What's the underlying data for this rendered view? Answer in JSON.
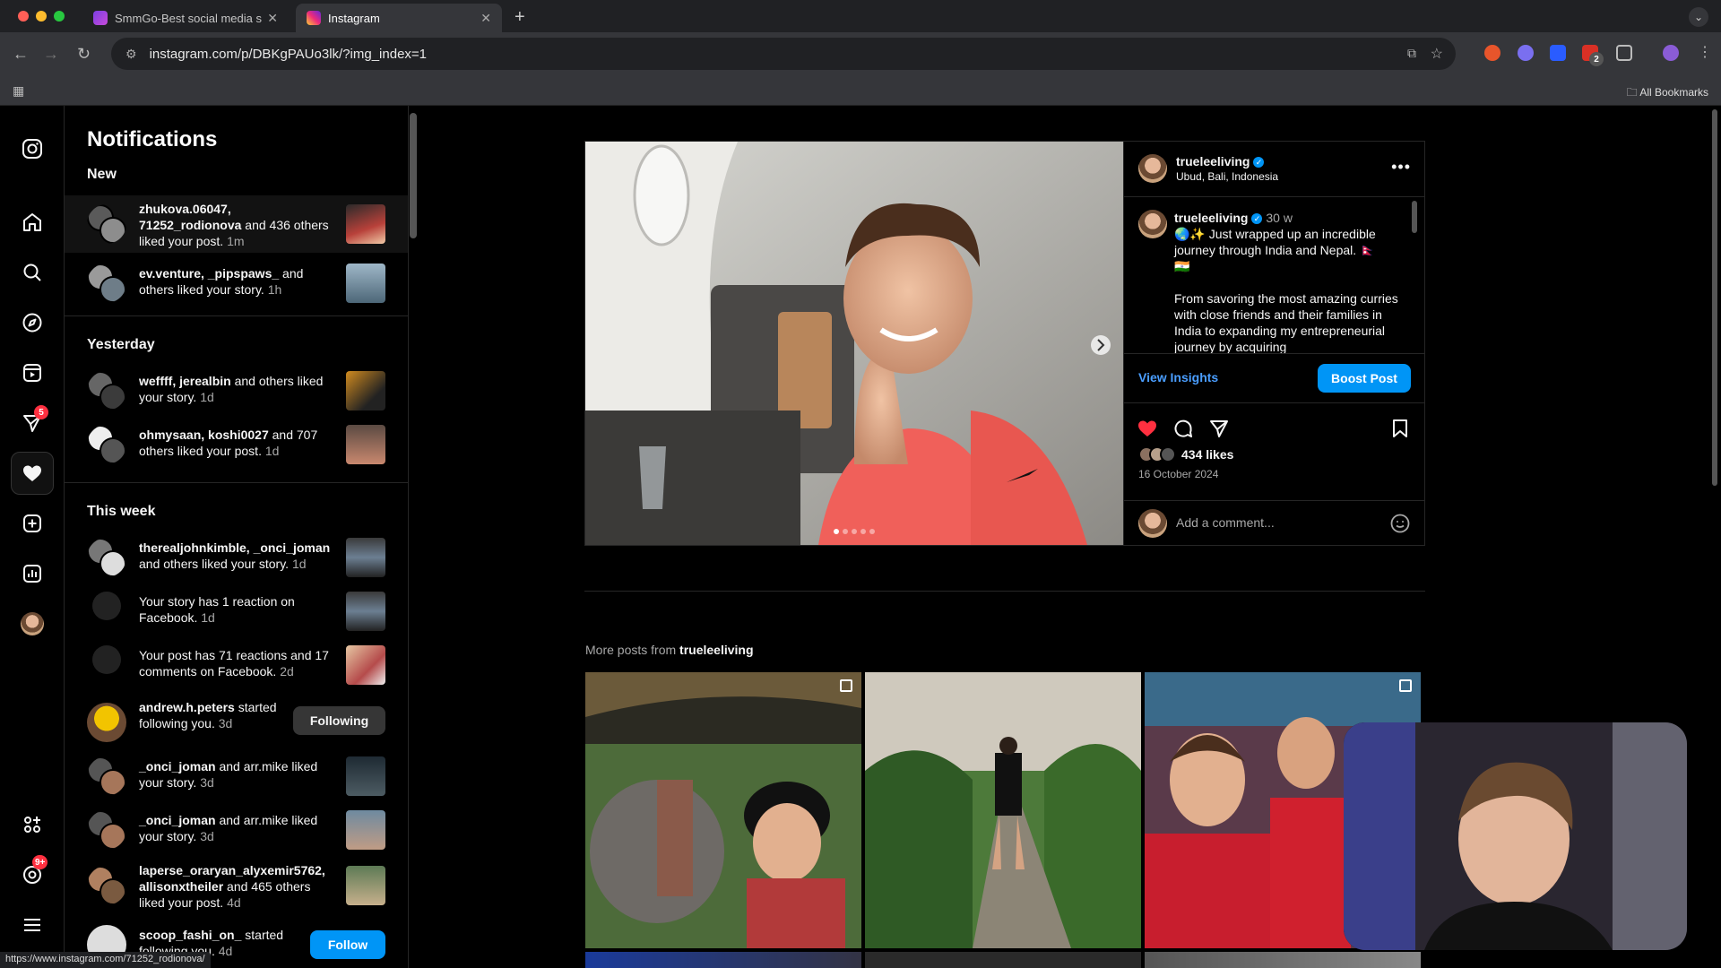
{
  "browser": {
    "tabs": [
      {
        "title": "SmmGo-Best social media se",
        "active": false
      },
      {
        "title": "Instagram",
        "active": true
      }
    ],
    "url": "instagram.com/p/DBKgPAUo3lk/?img_index=1",
    "bookmarks_label": "All Bookmarks",
    "status_url": "https://www.instagram.com/71252_rodionova/",
    "extension_badge": "2"
  },
  "rail": {
    "messages_badge": "5",
    "threads_badge": "9+"
  },
  "notifications": {
    "title": "Notifications",
    "sections": {
      "new": "New",
      "yesterday": "Yesterday",
      "this_week": "This week"
    },
    "items": [
      {
        "users": "zhukova.06047, 71252_rodionova",
        "text": " and 436 others liked your post.",
        "time": "1m"
      },
      {
        "users": "ev.venture, _pipspaws_",
        "text": " and others liked your story.",
        "time": "1h"
      },
      {
        "users": "weffff, jerealbin",
        "text": " and others liked your story.",
        "time": "1d"
      },
      {
        "users": "ohmysaan, koshi0027",
        "text": " and 707 others liked your post.",
        "time": "1d"
      },
      {
        "users": "therealjohnkimble, _onci_joman",
        "text": " and others liked your story.",
        "time": "1d"
      },
      {
        "users": "",
        "text": "Your story has 1 reaction on Facebook.",
        "time": "1d"
      },
      {
        "users": "",
        "text": "Your post has 71 reactions and 17 comments on Facebook.",
        "time": "2d"
      },
      {
        "users": "andrew.h.peters",
        "text": " started following you.",
        "time": "3d",
        "button": "Following"
      },
      {
        "users": "_onci_joman",
        "text": " and arr.mike liked your story.",
        "time": "3d"
      },
      {
        "users": "_onci_joman",
        "text": " and arr.mike liked your story.",
        "time": "3d"
      },
      {
        "users": "laperse_oraryan_alyxemir5762, allisonxtheiler",
        "text": " and 465 others liked your post.",
        "time": "4d"
      },
      {
        "users": "scoop_fashi_on_",
        "text": " started following you.",
        "time": "4d",
        "button": "Follow"
      }
    ]
  },
  "post": {
    "username": "trueleeliving",
    "location": "Ubud, Bali, Indonesia",
    "caption_time": "30 w",
    "caption_line1": "🌏✨ Just wrapped up an incredible journey through India and Nepal. 🇳🇵",
    "caption_line2": "🇮🇳",
    "caption_paragraph": "From savoring the most amazing curries with close friends and their families in India to expanding my entrepreneurial journey by acquiring",
    "view_insights": "View Insights",
    "boost_label": "Boost Post",
    "likes": "434 likes",
    "date": "16 October 2024",
    "comment_placeholder": "Add a comment...",
    "carousel_slides": 5,
    "current_slide": 1
  },
  "more_posts": {
    "label": "More posts from ",
    "username": "trueleeliving"
  },
  "colors": {
    "accent_blue": "#0095f6",
    "link_blue": "#4a9eff",
    "like_red": "#ff3040",
    "bg": "#000000",
    "border": "#262626"
  },
  "icons": [
    "instagram-icon",
    "home-icon",
    "search-icon",
    "explore-icon",
    "reels-icon",
    "messages-icon",
    "heart-icon",
    "create-icon",
    "dashboard-icon",
    "threads-icon",
    "meta-icon",
    "menu-icon",
    "more-icon",
    "comment-icon",
    "share-icon",
    "bookmark-icon",
    "emoji-icon",
    "chevron-right-icon"
  ]
}
